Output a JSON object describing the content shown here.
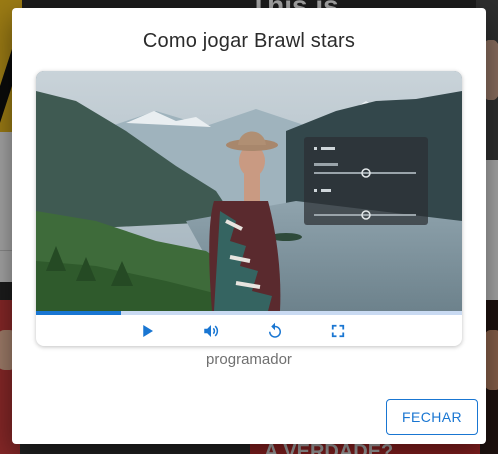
{
  "dialog": {
    "title": "Como jogar Brawl stars",
    "caption": "programador",
    "close_label": "FECHAR"
  },
  "player": {
    "progress": 0.2,
    "controls": [
      "play-icon",
      "volume-icon",
      "replay-icon",
      "fullscreen-icon"
    ],
    "accent": "#1976d2"
  },
  "background": {
    "top_text": "This is",
    "bottom_text": "A VERDADE?"
  }
}
